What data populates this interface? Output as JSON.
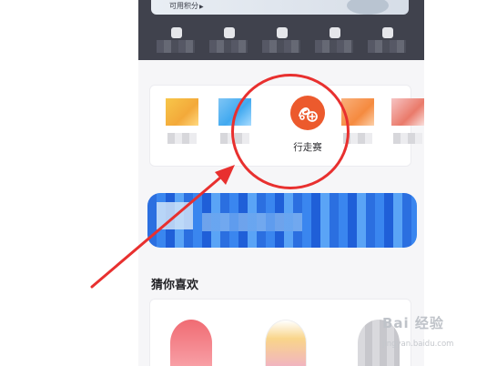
{
  "header": {
    "points_label": "可用积分"
  },
  "quick_actions": [
    {
      "icon": "clock-icon"
    },
    {
      "icon": "heart-icon"
    },
    {
      "icon": "document-icon"
    },
    {
      "icon": "card-icon"
    },
    {
      "icon": "grid-icon"
    }
  ],
  "service_grid": {
    "highlight": {
      "label": "行走赛",
      "icon": "walking-race-icon",
      "color": "#ec5a2d"
    }
  },
  "recommend": {
    "title": "猜你喜欢"
  },
  "annotation": {
    "color": "#e8302f"
  },
  "watermark": {
    "main": "Bai 经验",
    "sub": "jingyan.baidu.com"
  }
}
